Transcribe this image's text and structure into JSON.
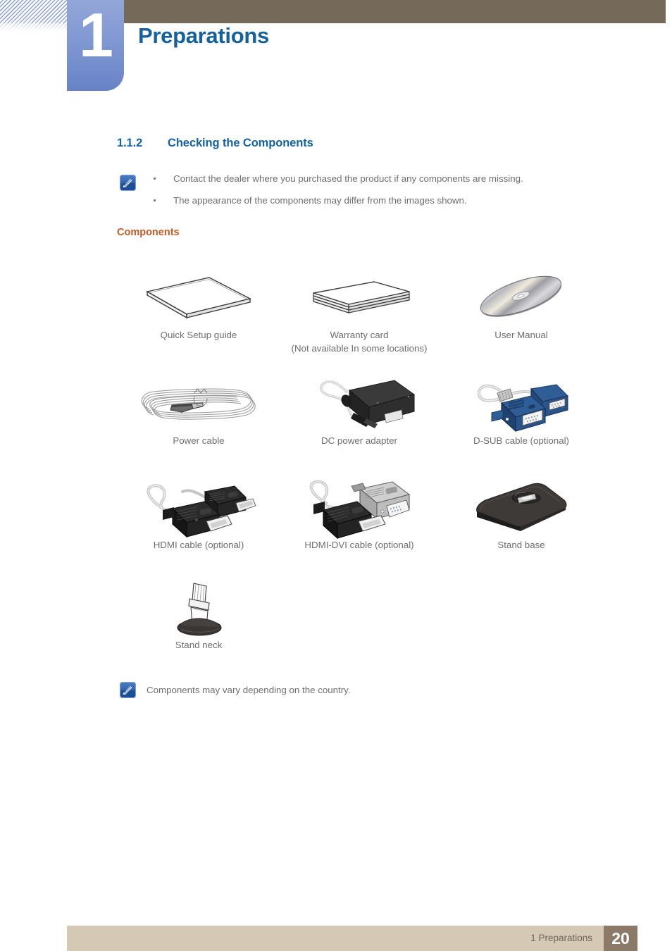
{
  "header": {
    "chapter_number": "1",
    "chapter_title": "Preparations",
    "brown_bar_color": "#756a59",
    "tab_color": "#8098d2",
    "title_color": "#15619d"
  },
  "section": {
    "number": "1.1.2",
    "title": "Checking the Components"
  },
  "notes_top": {
    "icon": "note-pen-icon",
    "bullets": [
      "Contact the dealer where you purchased the product if any components are missing.",
      "The appearance of the components may differ from the images shown."
    ]
  },
  "components_label": {
    "text": "Components",
    "color": "#c05b26"
  },
  "components": [
    {
      "icon": "booklet-icon",
      "caption": "Quick Setup guide",
      "caption2": ""
    },
    {
      "icon": "card-stack-icon",
      "caption": "Warranty card",
      "caption2": "(Not available In some locations)"
    },
    {
      "icon": "cd-disc-icon",
      "caption": "User Manual",
      "caption2": ""
    },
    {
      "icon": "power-cable-icon",
      "caption": "Power cable",
      "caption2": ""
    },
    {
      "icon": "dc-adapter-icon",
      "caption": "DC power adapter",
      "caption2": ""
    },
    {
      "icon": "dsub-cable-icon",
      "caption": "D-SUB cable (optional)",
      "caption2": ""
    },
    {
      "icon": "hdmi-cable-icon",
      "caption": "HDMI cable (optional)",
      "caption2": ""
    },
    {
      "icon": "hdmi-dvi-cable-icon",
      "caption": "HDMI-DVI cable (optional)",
      "caption2": ""
    },
    {
      "icon": "stand-base-icon",
      "caption": "Stand base",
      "caption2": ""
    },
    {
      "icon": "stand-neck-icon",
      "caption": "Stand neck",
      "caption2": ""
    }
  ],
  "note_bottom": {
    "icon": "note-pen-icon",
    "text": "Components may vary depending on the country."
  },
  "footer": {
    "chapter_ref": "1 Preparations",
    "page_number": "20",
    "bar_color": "#d5c8b4",
    "page_box_color": "#8b7a68"
  }
}
